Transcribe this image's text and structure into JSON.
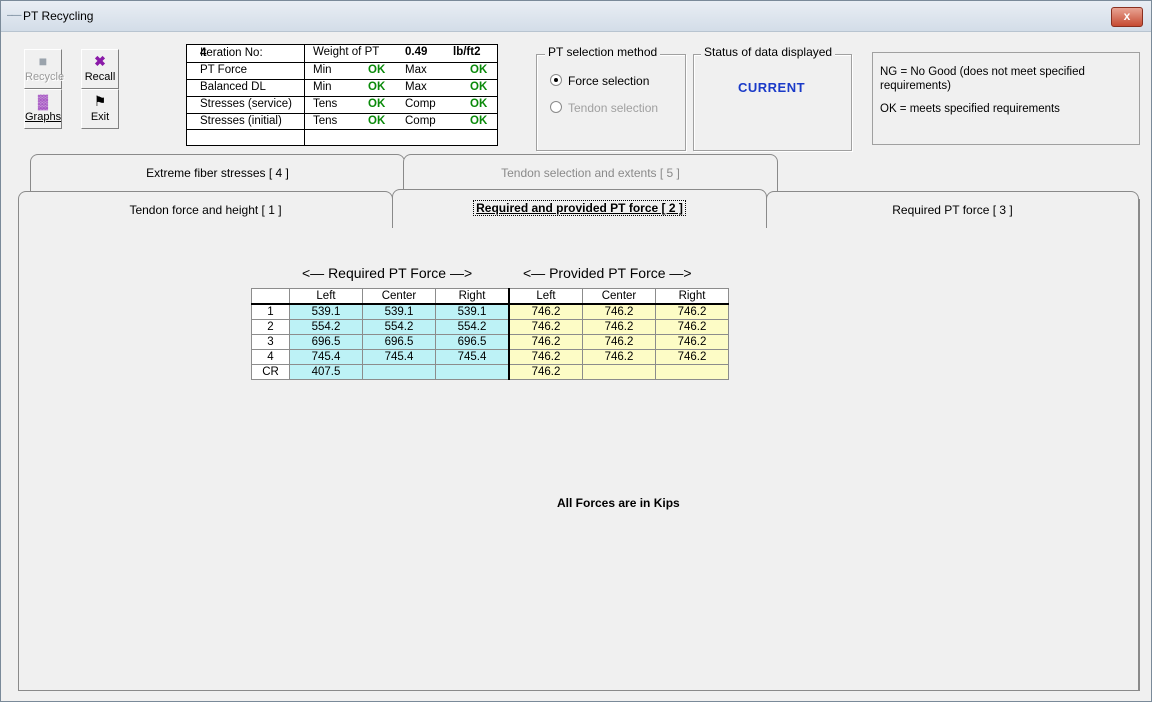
{
  "window": {
    "title": "PT Recycling",
    "close_label": "x"
  },
  "toolbar": [
    {
      "label": "Recycle",
      "icon": "recycle-icon",
      "enabled": false
    },
    {
      "label": "Recall",
      "icon": "recall-icon",
      "enabled": true
    },
    {
      "label": "Graphs",
      "icon": "graphs-icon",
      "enabled": true
    },
    {
      "label": "Exit",
      "icon": "exit-flag-icon",
      "enabled": true
    }
  ],
  "status": {
    "iteration_label": "Iteration No:",
    "iteration_value": "4",
    "weight_label": "Weight of PT",
    "weight_value": "0.49",
    "weight_unit": "lb/ft2",
    "rows": [
      {
        "name": "PT Force",
        "a_label": "Min",
        "a_val": "OK",
        "b_label": "Max",
        "b_val": "OK"
      },
      {
        "name": "Balanced DL",
        "a_label": "Min",
        "a_val": "OK",
        "b_label": "Max",
        "b_val": "OK"
      },
      {
        "name": "Stresses (service)",
        "a_label": "Tens",
        "a_val": "OK",
        "b_label": "Comp",
        "b_val": "OK"
      },
      {
        "name": "Stresses (initial)",
        "a_label": "Tens",
        "a_val": "OK",
        "b_label": "Comp",
        "b_val": "OK"
      }
    ]
  },
  "pt_method": {
    "title": "PT selection method",
    "force_label": "Force selection",
    "tendon_label": "Tendon selection",
    "selected": "force"
  },
  "data_status": {
    "title": "Status of data displayed",
    "value": "CURRENT"
  },
  "notes": {
    "ng": "NG = No Good (does not meet specified requirements)",
    "ok": "OK = meets specified requirements"
  },
  "tabs": [
    {
      "label": "Extreme fiber stresses [ 4 ]"
    },
    {
      "label": "Tendon selection and extents [ 5 ]"
    },
    {
      "label": "Tendon force and height [ 1 ]"
    },
    {
      "label": "Required and provided PT force [ 2 ]"
    },
    {
      "label": "Required PT force [ 3 ]"
    }
  ],
  "panel": {
    "required_header": "<— Required PT Force —>",
    "provided_header": "<— Provided PT Force —>",
    "columns": [
      "Left",
      "Center",
      "Right",
      "Left",
      "Center",
      "Right"
    ],
    "rows": [
      {
        "label": "1",
        "req": [
          "539.1",
          "539.1",
          "539.1"
        ],
        "prov": [
          "746.2",
          "746.2",
          "746.2"
        ]
      },
      {
        "label": "2",
        "req": [
          "554.2",
          "554.2",
          "554.2"
        ],
        "prov": [
          "746.2",
          "746.2",
          "746.2"
        ]
      },
      {
        "label": "3",
        "req": [
          "696.5",
          "696.5",
          "696.5"
        ],
        "prov": [
          "746.2",
          "746.2",
          "746.2"
        ]
      },
      {
        "label": "4",
        "req": [
          "745.4",
          "745.4",
          "745.4"
        ],
        "prov": [
          "746.2",
          "746.2",
          "746.2"
        ]
      },
      {
        "label": "CR",
        "req": [
          "407.5",
          "",
          ""
        ],
        "prov": [
          "746.2",
          "",
          ""
        ]
      }
    ],
    "units_note": "All Forces are in Kips"
  }
}
